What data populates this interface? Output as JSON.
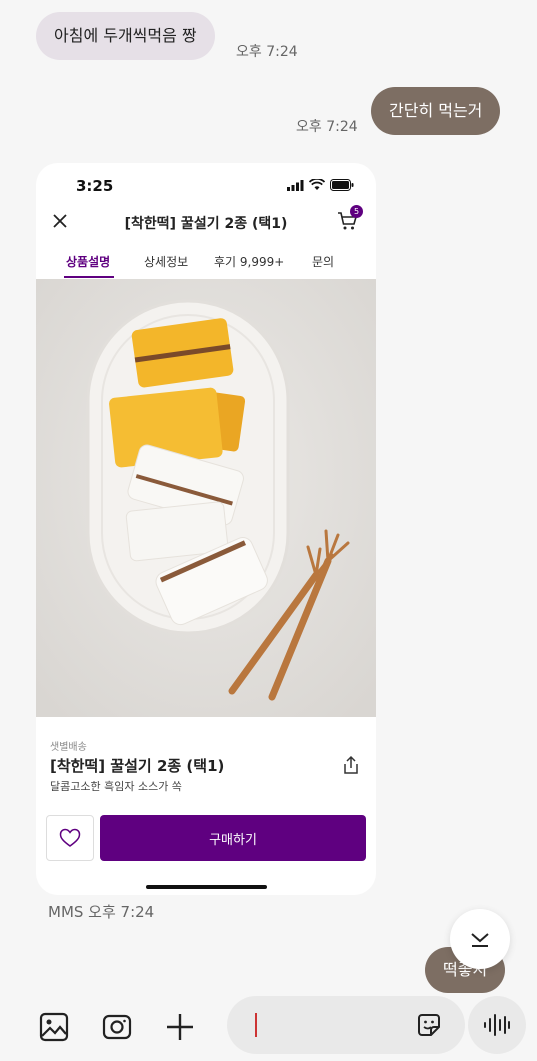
{
  "messages": [
    {
      "direction": "in",
      "text": "아침에 두개씩먹음 짱",
      "time": "오후 7:24"
    },
    {
      "direction": "out",
      "text": "간단히 먹는거",
      "time": "오후 7:24"
    },
    {
      "direction": "out",
      "text": "떡좋지"
    }
  ],
  "shared_image": {
    "time_label": "MMS 오후 7:24",
    "status_time": "3:25",
    "product_title_bar": "[착한떡] 꿀설기 2종 (택1)",
    "cart_count": "5",
    "tabs": [
      "상품설명",
      "상세정보",
      "후기 9,999+",
      "문의"
    ],
    "active_tab": "상품설명",
    "delivery_label": "샛별배송",
    "product_name": "[착한떡] 꿀설기 2종 (택1)",
    "product_desc": "달콤고소한 흑임자 소스가 쏙",
    "buy_label": "구매하기"
  },
  "colors": {
    "accent": "#5f0080",
    "bubble_out": "#7d6e63",
    "bubble_in": "#e6e0e7"
  },
  "icons": {
    "gallery": "image-icon",
    "camera": "camera-icon",
    "add": "plus-icon",
    "emoji": "sticker-icon",
    "voice": "voice-wave-icon",
    "scroll": "chevron-down-icon"
  }
}
